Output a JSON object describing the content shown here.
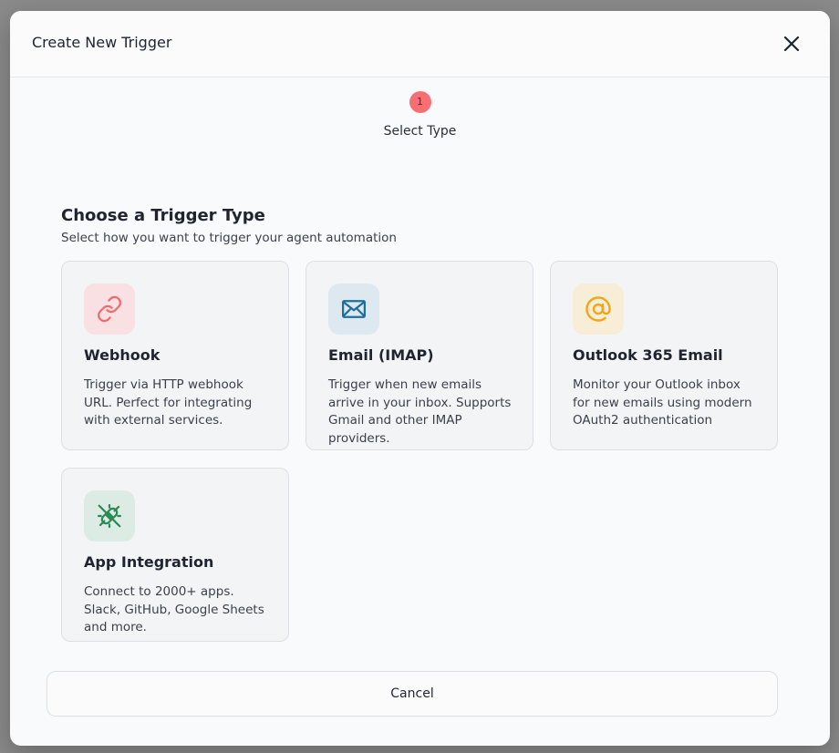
{
  "modal": {
    "title": "Create New Trigger",
    "close_icon": "close-icon"
  },
  "stepper": {
    "steps": [
      {
        "number": "1",
        "label": "Select Type",
        "color": "#f76f73"
      }
    ]
  },
  "section": {
    "title": "Choose a Trigger Type",
    "subtitle": "Select how you want to trigger your agent automation"
  },
  "trigger_types": [
    {
      "title": "Webhook",
      "description": "Trigger via HTTP webhook URL. Perfect for integrating with external services.",
      "icon": "link-icon",
      "icon_color": "#ef6b6f",
      "icon_bg": "#f9e1e3"
    },
    {
      "title": "Email (IMAP)",
      "description": "Trigger when new emails arrive in your inbox. Supports Gmail and other IMAP providers.",
      "icon": "mail-icon",
      "icon_color": "#1f6f9a",
      "icon_bg": "#dde8f0"
    },
    {
      "title": "Outlook 365 Email",
      "description": "Monitor your Outlook inbox for new emails using modern OAuth2 authentication",
      "icon": "at-sign-icon",
      "icon_color": "#f2a516",
      "icon_bg": "#f8edd6"
    },
    {
      "title": "App Integration",
      "description": "Connect to 2000+ apps. Slack, GitHub, Google Sheets and more.",
      "icon": "plug-icon",
      "icon_color": "#2c8a55",
      "icon_bg": "#dcebe3"
    }
  ],
  "footer": {
    "cancel_label": "Cancel"
  }
}
